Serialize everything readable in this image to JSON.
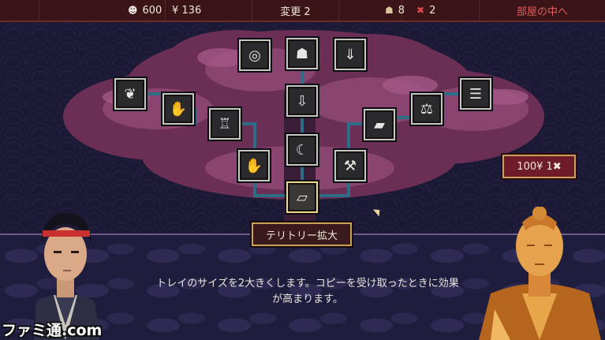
{
  "topbar": {
    "money": "600",
    "yen": "¥ 136",
    "change": "変更 2",
    "mask": "8",
    "lives": "2",
    "room_link": "部屋の中へ"
  },
  "icons": {
    "money": "face-coin-icon",
    "mask": "demon-mask-icon",
    "lives": "red-flower-icon"
  },
  "price_button": "100¥ 1✖",
  "skill_title": "テリトリー拡大",
  "description": {
    "line1": "トレイのサイズを2大きくします。コピーを受け取ったときに効果",
    "line2": "が高まります。"
  },
  "watermark": "ファミ通.com",
  "colors": {
    "topbar": "#3b1417",
    "accent_red": "#e35a5a",
    "gold_border": "#c9a257",
    "connector": "#2d6e86",
    "tree_pink": "#7a3a5e"
  }
}
